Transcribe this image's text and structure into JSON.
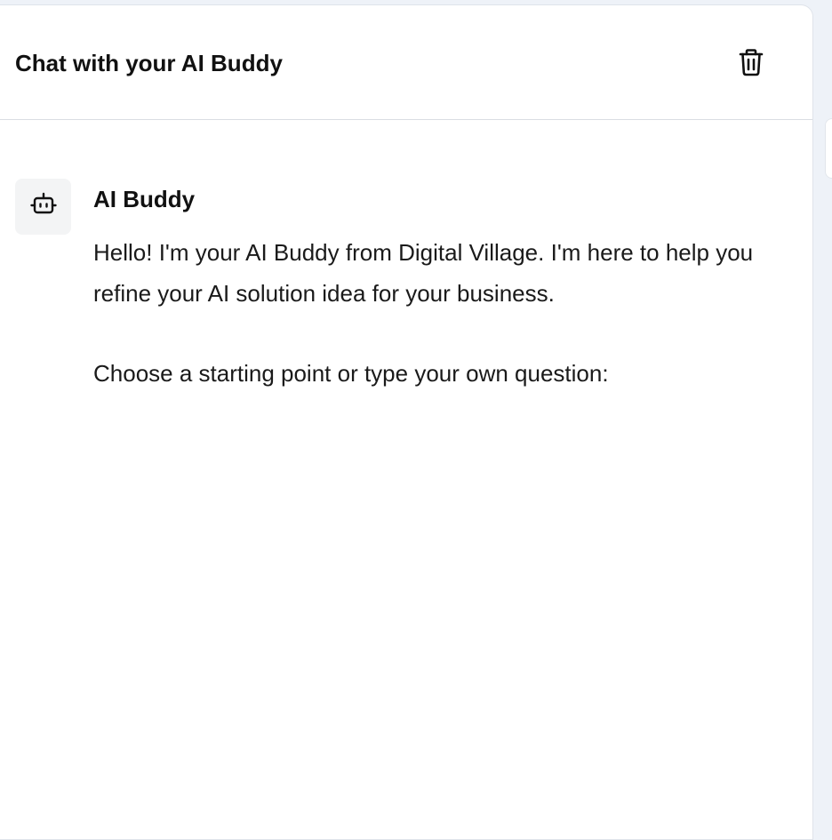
{
  "header": {
    "title": "Chat with your AI Buddy",
    "delete_icon": "trash-icon"
  },
  "message": {
    "avatar_icon": "robot-icon",
    "sender": "AI Buddy",
    "greeting": "Hello! I'm your AI Buddy from Digital Village. I'm here to help you refine your AI solution idea for your business.",
    "prompt": "Choose a starting point or type your own question:"
  },
  "colors": {
    "background": "#eef2f8",
    "panel": "#ffffff",
    "text": "#111111",
    "avatar_bg": "#f3f4f5"
  }
}
